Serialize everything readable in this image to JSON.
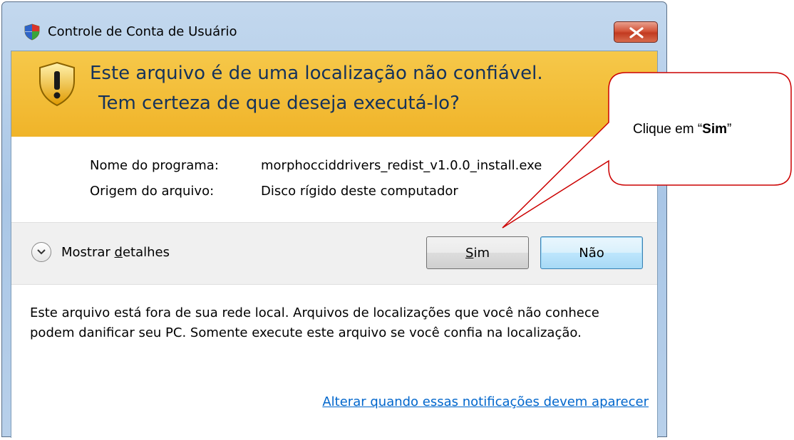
{
  "window": {
    "title": "Controle de Conta de Usuário"
  },
  "banner": {
    "line1": "Este arquivo é de uma localização não confiável.",
    "line2": "Tem certeza de que deseja executá-lo?"
  },
  "info": {
    "program_label": "Nome do programa:",
    "program_value": "morphocciddrivers_redist_v1.0.0_install.exe",
    "origin_label": "Origem do arquivo:",
    "origin_value": "Disco rígido deste computador"
  },
  "details": {
    "label_prefix": "Mostrar ",
    "label_accel": "d",
    "label_suffix": "etalhes"
  },
  "buttons": {
    "yes_accel": "S",
    "yes_rest": "im",
    "no_label": "Não"
  },
  "description": "Este arquivo está fora de sua rede local. Arquivos de localizações que você não conhece podem danificar seu PC. Somente execute este arquivo se você confia na localização.",
  "settings_link": "Alterar quando essas notificações devem aparecer",
  "callout": {
    "prefix": "Clique em “",
    "bold": "Sim",
    "suffix": "”"
  },
  "colors": {
    "banner": "#f0b429",
    "headline": "#14325c",
    "link": "#0066cc",
    "callout_border": "#cc0000"
  }
}
